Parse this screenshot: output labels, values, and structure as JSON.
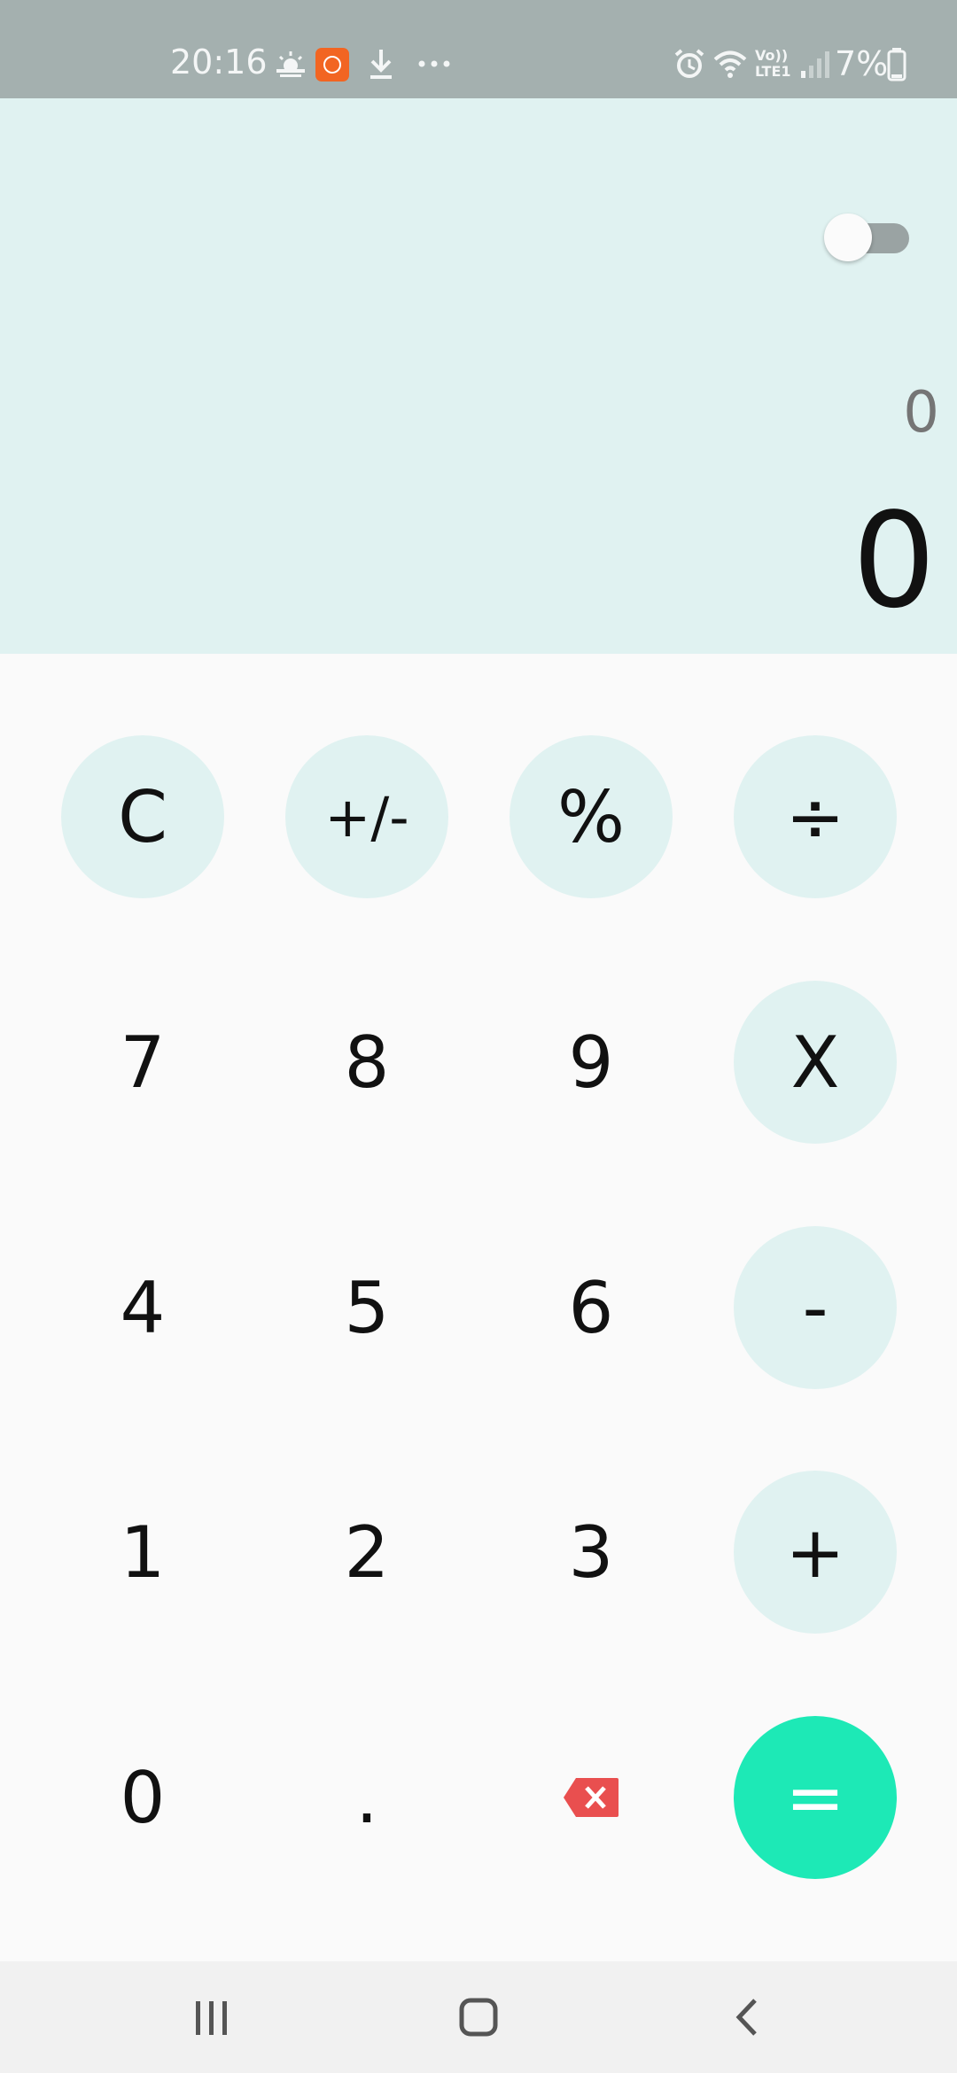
{
  "status_bar": {
    "time": "20:16",
    "icons_left": [
      "weather-icon",
      "app-notification-icon",
      "download-icon",
      "more-dots-icon"
    ],
    "icons_right": [
      "alarm-icon",
      "wifi-icon",
      "volte-lte-icon",
      "signal-icon",
      "battery-icon"
    ],
    "volte_label": "Vo)) LTE1",
    "battery": "7%"
  },
  "display": {
    "expression": "0",
    "result": "0"
  },
  "keypad": {
    "rows": [
      [
        "C",
        "+/-",
        "%",
        "÷"
      ],
      [
        "7",
        "8",
        "9",
        "X"
      ],
      [
        "4",
        "5",
        "6",
        "-"
      ],
      [
        "1",
        "2",
        "3",
        "+"
      ],
      [
        "0",
        ".",
        "backspace",
        "="
      ]
    ]
  },
  "colors": {
    "display_bg": "#e0f2f1",
    "operator_bg": "#e0f2f1",
    "equals_bg": "#1de9b6",
    "backspace": "#e94f4f",
    "status_bar_bg": "#a4b0af"
  },
  "nav_bar": {
    "icons": [
      "recent-apps-icon",
      "home-icon",
      "back-icon"
    ]
  }
}
